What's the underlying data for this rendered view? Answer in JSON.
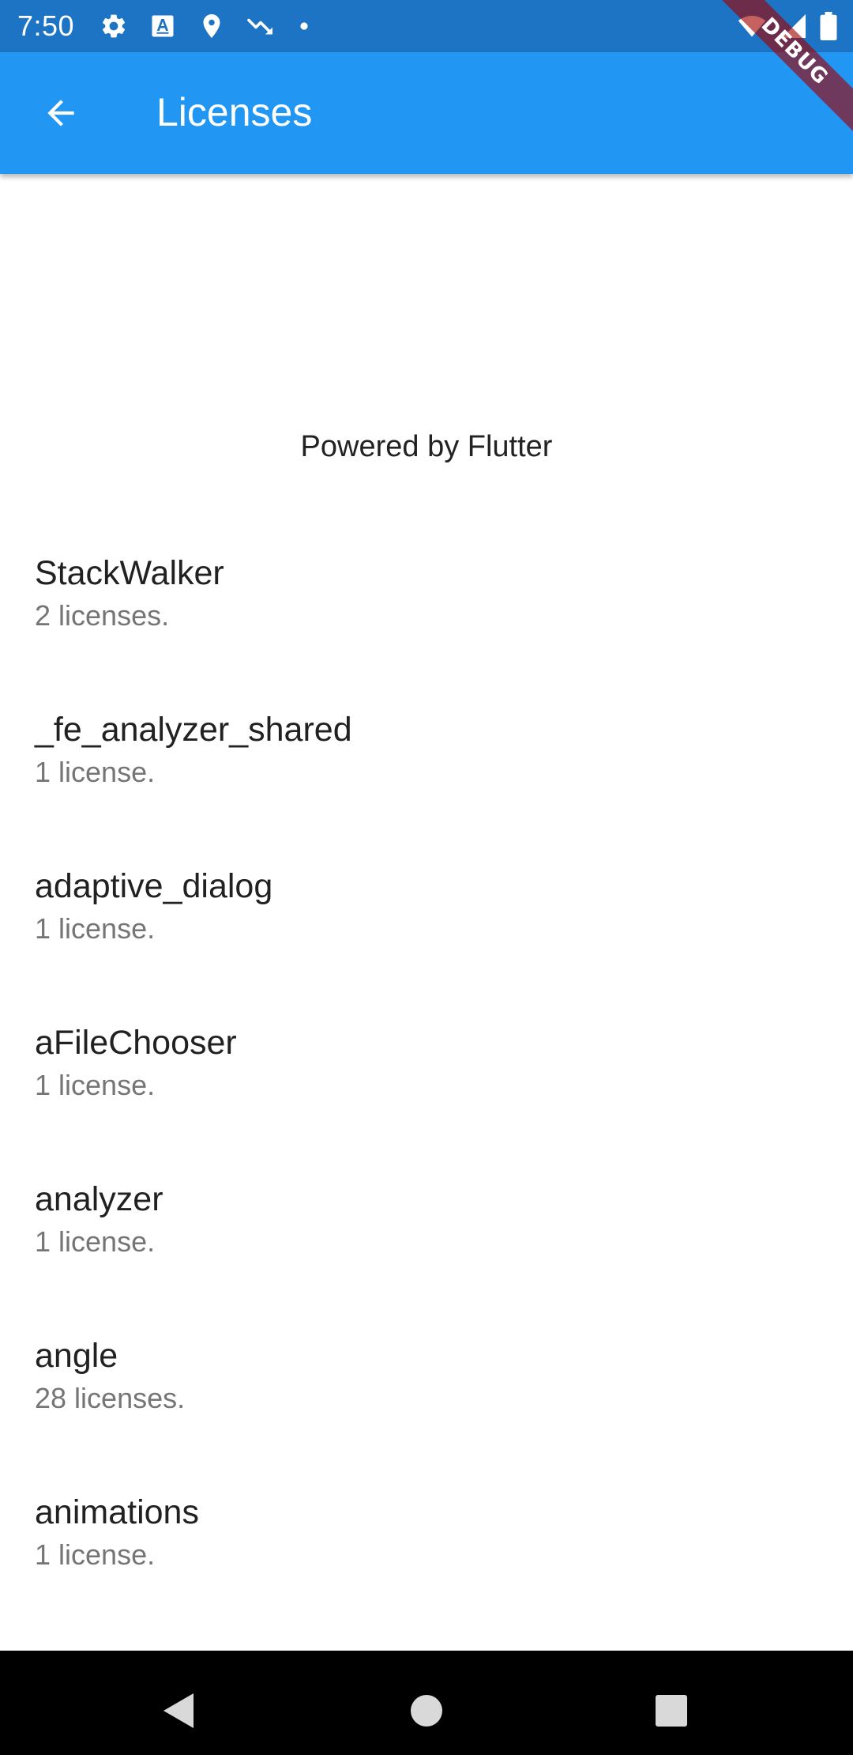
{
  "status_bar": {
    "time": "7:50",
    "left_icons": [
      "settings-icon",
      "font-icon",
      "location-icon",
      "trending-down-icon",
      "dot-icon"
    ],
    "right_icons": [
      "wifi-icon",
      "signal-icon",
      "battery-icon"
    ]
  },
  "app_bar": {
    "title": "Licenses",
    "back_icon": "arrow-back-icon",
    "color": "#2196f3"
  },
  "debug_banner": "DEBUG",
  "powered_by": "Powered by Flutter",
  "packages": [
    {
      "name": "StackWalker",
      "count": "2 licenses."
    },
    {
      "name": "_fe_analyzer_shared",
      "count": "1 license."
    },
    {
      "name": "adaptive_dialog",
      "count": "1 license."
    },
    {
      "name": "aFileChooser",
      "count": "1 license."
    },
    {
      "name": "analyzer",
      "count": "1 license."
    },
    {
      "name": "angle",
      "count": "28 licenses."
    },
    {
      "name": "animations",
      "count": "1 license."
    }
  ],
  "nav_bar": {
    "icons": [
      "nav-back-icon",
      "nav-home-icon",
      "nav-recents-icon"
    ]
  }
}
